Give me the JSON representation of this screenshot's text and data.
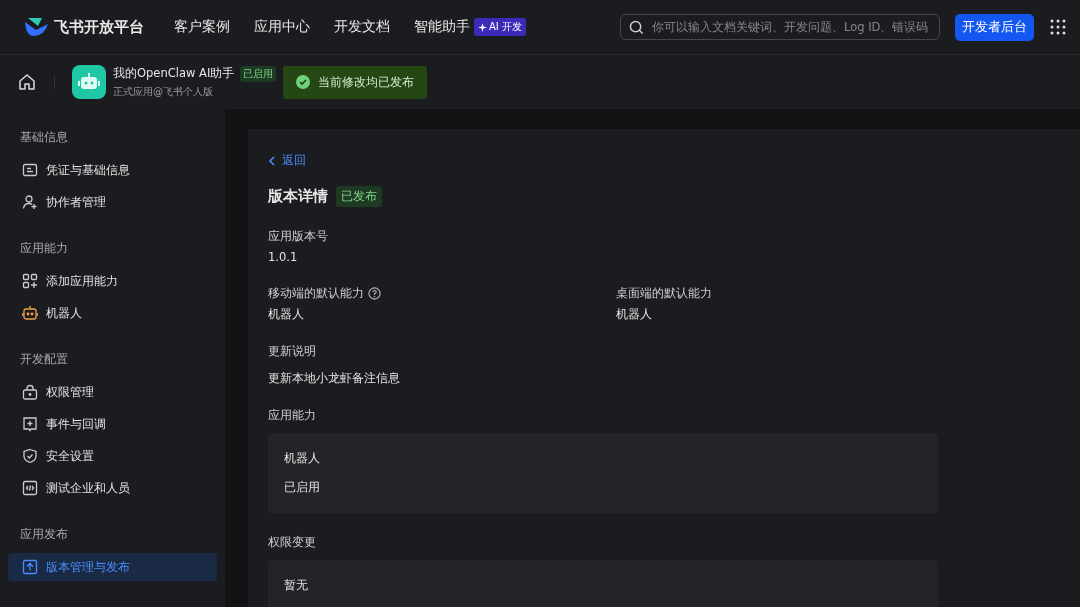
{
  "header": {
    "logo": "飞书开放平台",
    "nav": [
      {
        "label": "客户案例"
      },
      {
        "label": "应用中心"
      },
      {
        "label": "开发文档"
      },
      {
        "label": "智能助手",
        "badge": "AI 开发"
      }
    ],
    "search": {
      "placeholder": "你可以输入文档关键词、开发问题、Log ID、错误码"
    },
    "console_button": "开发者后台"
  },
  "app_bar": {
    "name": "我的OpenClaw AI助手",
    "status": "已启用",
    "subtitle": "正式应用@飞书个人版",
    "notice": "当前修改均已发布"
  },
  "sidebar": {
    "sections": [
      {
        "title": "基础信息",
        "items": [
          {
            "label": "凭证与基础信息",
            "kind": "card",
            "selected": false
          },
          {
            "label": "协作者管理",
            "kind": "collaborator",
            "selected": false
          }
        ]
      },
      {
        "title": "应用能力",
        "items": [
          {
            "label": "添加应用能力",
            "kind": "abilities",
            "selected": false
          },
          {
            "label": "机器人",
            "kind": "robot",
            "selected": false
          }
        ]
      },
      {
        "title": "开发配置",
        "items": [
          {
            "label": "权限管理",
            "kind": "lock",
            "selected": false
          },
          {
            "label": "事件与回调",
            "kind": "event",
            "selected": false
          },
          {
            "label": "安全设置",
            "kind": "shield",
            "selected": false
          },
          {
            "label": "测试企业和人员",
            "kind": "code",
            "selected": false
          }
        ]
      },
      {
        "title": "应用发布",
        "items": [
          {
            "label": "版本管理与发布",
            "kind": "upload",
            "selected": true
          }
        ]
      }
    ]
  },
  "detail": {
    "back": "返回",
    "title": "版本详情",
    "status": "已发布",
    "version": {
      "label": "应用版本号",
      "value": "1.0.1"
    },
    "defaults": [
      {
        "label": "移动端的默认能力",
        "help": true,
        "value": "机器人"
      },
      {
        "label": "桌面端的默认能力",
        "help": false,
        "value": "机器人"
      }
    ],
    "notes": {
      "label": "更新说明",
      "value": "更新本地小龙虾备注信息"
    },
    "capabilities": {
      "label": "应用能力",
      "name": "机器人",
      "state": "已启用"
    },
    "permissions": {
      "label": "权限变更",
      "value": "暂无"
    }
  }
}
